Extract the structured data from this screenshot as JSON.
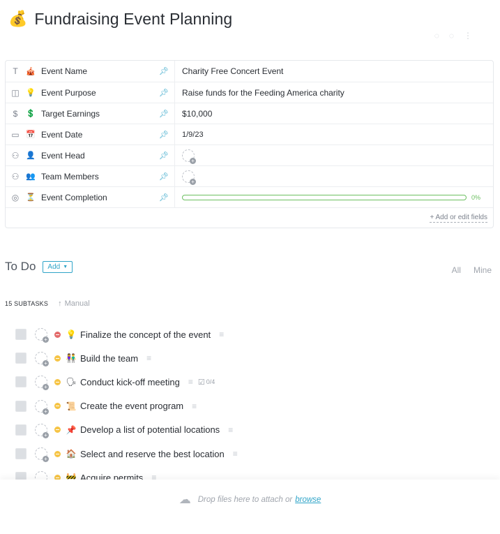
{
  "page": {
    "emoji": "💰",
    "title": "Fundraising Event Planning"
  },
  "fields": [
    {
      "type_icon": "T",
      "type_icon_name": "text-type-icon",
      "emoji": "🎪",
      "name": "Event Name",
      "value": "Charity Free Concert Event",
      "kind": "text"
    },
    {
      "type_icon": "◫",
      "type_icon_name": "textarea-type-icon",
      "emoji": "💡",
      "name": "Event Purpose",
      "value": "Raise funds for the Feeding America charity",
      "kind": "text"
    },
    {
      "type_icon": "$",
      "type_icon_name": "currency-type-icon",
      "emoji": "💲",
      "name": "Target Earnings",
      "value": "$10,000",
      "kind": "text"
    },
    {
      "type_icon": "▭",
      "type_icon_name": "date-type-icon",
      "emoji": "📅",
      "name": "Event Date",
      "value": "1/9/23",
      "kind": "date"
    },
    {
      "type_icon": "⚇",
      "type_icon_name": "people-type-icon",
      "emoji": "👤",
      "name": "Event Head",
      "value": "",
      "kind": "person"
    },
    {
      "type_icon": "⚇",
      "type_icon_name": "people-type-icon",
      "emoji": "👥",
      "name": "Team Members",
      "value": "",
      "kind": "person"
    },
    {
      "type_icon": "◎",
      "type_icon_name": "progress-type-icon",
      "emoji": "⏳",
      "name": "Event Completion",
      "value": "0%",
      "progress": 0,
      "kind": "progress"
    }
  ],
  "fields_footer": {
    "add_edit_label": "+ Add or edit fields"
  },
  "todo": {
    "title": "To Do",
    "add_label": "Add",
    "filters": [
      "All",
      "Mine"
    ],
    "subtask_count_label": "15 SUBTASKS",
    "sort_label": "Manual"
  },
  "tasks": [
    {
      "priority": "urgent",
      "emoji": "💡",
      "name": "Finalize the concept of the event",
      "has_desc": true
    },
    {
      "priority": "normal",
      "emoji": "👫",
      "name": "Build the team",
      "has_desc": true
    },
    {
      "priority": "normal",
      "emoji": "🗣",
      "name": "Conduct kick-off meeting",
      "has_desc": true,
      "checklist": "0/4"
    },
    {
      "priority": "normal",
      "emoji": "📜",
      "name": "Create the event program",
      "has_desc": true
    },
    {
      "priority": "normal",
      "emoji": "📌",
      "name": "Develop a list of potential locations",
      "has_desc": true
    },
    {
      "priority": "normal",
      "emoji": "🏠",
      "name": "Select and reserve the best location",
      "has_desc": true
    },
    {
      "priority": "normal",
      "emoji": "🚧",
      "name": "Acquire permits",
      "has_desc": true
    }
  ],
  "dropzone": {
    "text": "Drop files here to attach or",
    "link": "browse"
  },
  "colors": {
    "accent": "#2fa4c8",
    "progress": "#6bbf60",
    "urgent": "#e36a6a",
    "normal": "#f6c445"
  }
}
